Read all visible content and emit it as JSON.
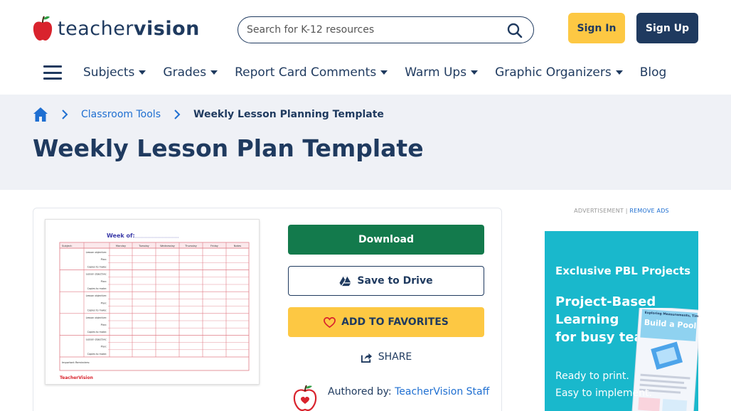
{
  "header": {
    "logo_text_light": "teacher",
    "logo_text_bold": "vision",
    "search_placeholder": "Search for K-12 resources",
    "signin_label": "Sign In",
    "signup_label": "Sign Up"
  },
  "nav": {
    "items": [
      {
        "label": "Subjects",
        "dropdown": true
      },
      {
        "label": "Grades",
        "dropdown": true
      },
      {
        "label": "Report Card Comments",
        "dropdown": true
      },
      {
        "label": "Warm Ups",
        "dropdown": true
      },
      {
        "label": "Graphic Organizers",
        "dropdown": true
      },
      {
        "label": "Blog",
        "dropdown": false
      }
    ]
  },
  "breadcrumb": {
    "items": [
      "Classroom Tools",
      "Weekly Lesson Planning Template"
    ]
  },
  "page_title": "Weekly Lesson Plan Template",
  "resource": {
    "thumbnail": {
      "heading": "Week of:",
      "columns": [
        "Subject:",
        "",
        "Monday",
        "Tuesday",
        "Wednesday",
        "Thursday",
        "Friday",
        "Notes"
      ],
      "row_labels": [
        "Lesson objective:",
        "Plan:",
        "Copies to make:"
      ],
      "footer_label": "Important Reminders:",
      "brand": "TeacherVision"
    },
    "download_label": "Download",
    "drive_label": "Save to Drive",
    "favorites_label": "ADD TO FAVORITES",
    "share_label": "SHARE",
    "author_prefix": "Authored by:",
    "author_name": "TeacherVision Staff"
  },
  "ad": {
    "label": "ADVERTISEMENT |",
    "remove_label": "REMOVE ADS",
    "kicker": "Exclusive PBL Projects",
    "headline_lines": [
      "Project-Based",
      "Learning",
      "for busy teachers"
    ],
    "sub_lines": [
      "Ready to print.",
      "Easy to implement."
    ],
    "book_title": "Build a Pool at Your School",
    "book_supertitle": "Exploring Measurements, Time and Graphing"
  },
  "colors": {
    "navy": "#1f3a5f",
    "yellow": "#fdc843",
    "green": "#137a4c",
    "link_blue": "#1f6fd1",
    "band_bg": "#eff1f6",
    "ad_teal": "#19b8cc",
    "apple_red": "#d9232d"
  },
  "icons": {
    "search": "search-icon",
    "home": "home-icon",
    "chevron": "chevron-right-icon",
    "drive": "google-drive-icon",
    "heart": "heart-icon",
    "share": "share-icon",
    "menu": "hamburger-menu-icon",
    "logo": "apple-logo-icon"
  }
}
